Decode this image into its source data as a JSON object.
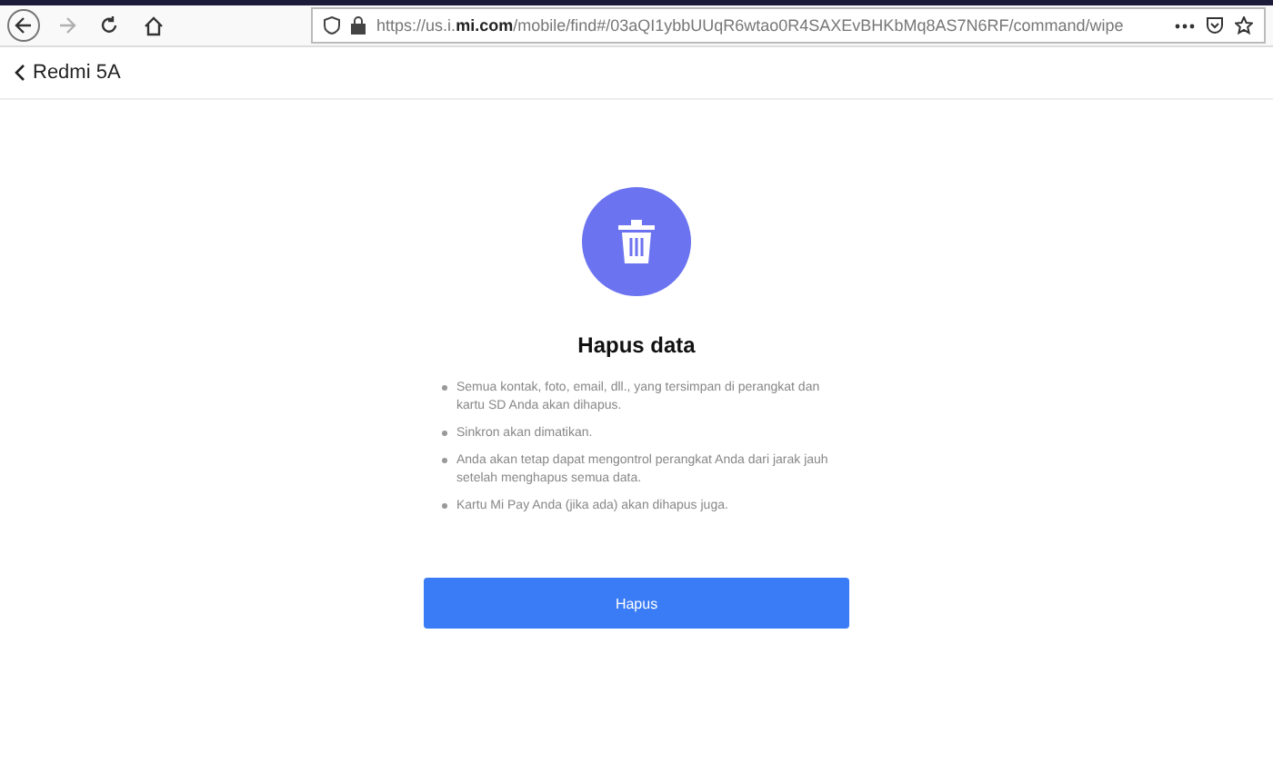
{
  "browser": {
    "url": "https://us.i.**mi.com**/mobile/find#/03aQI1ybbUUqR6wtao0R4SAXEvBHKbMq8AS7N6RF/command/wipe",
    "forward_disabled": true
  },
  "header": {
    "back_label": "Redmi 5A"
  },
  "dialog": {
    "title": "Hapus data",
    "bullets": [
      "Semua kontak, foto, email, dll., yang tersimpan di perangkat dan kartu SD Anda akan dihapus.",
      "Sinkron akan dimatikan.",
      "Anda akan tetap dapat mengontrol perangkat Anda dari jarak jauh setelah menghapus semua data.",
      "Kartu Mi Pay Anda (jika ada) akan dihapus juga."
    ],
    "button": "Hapus"
  }
}
